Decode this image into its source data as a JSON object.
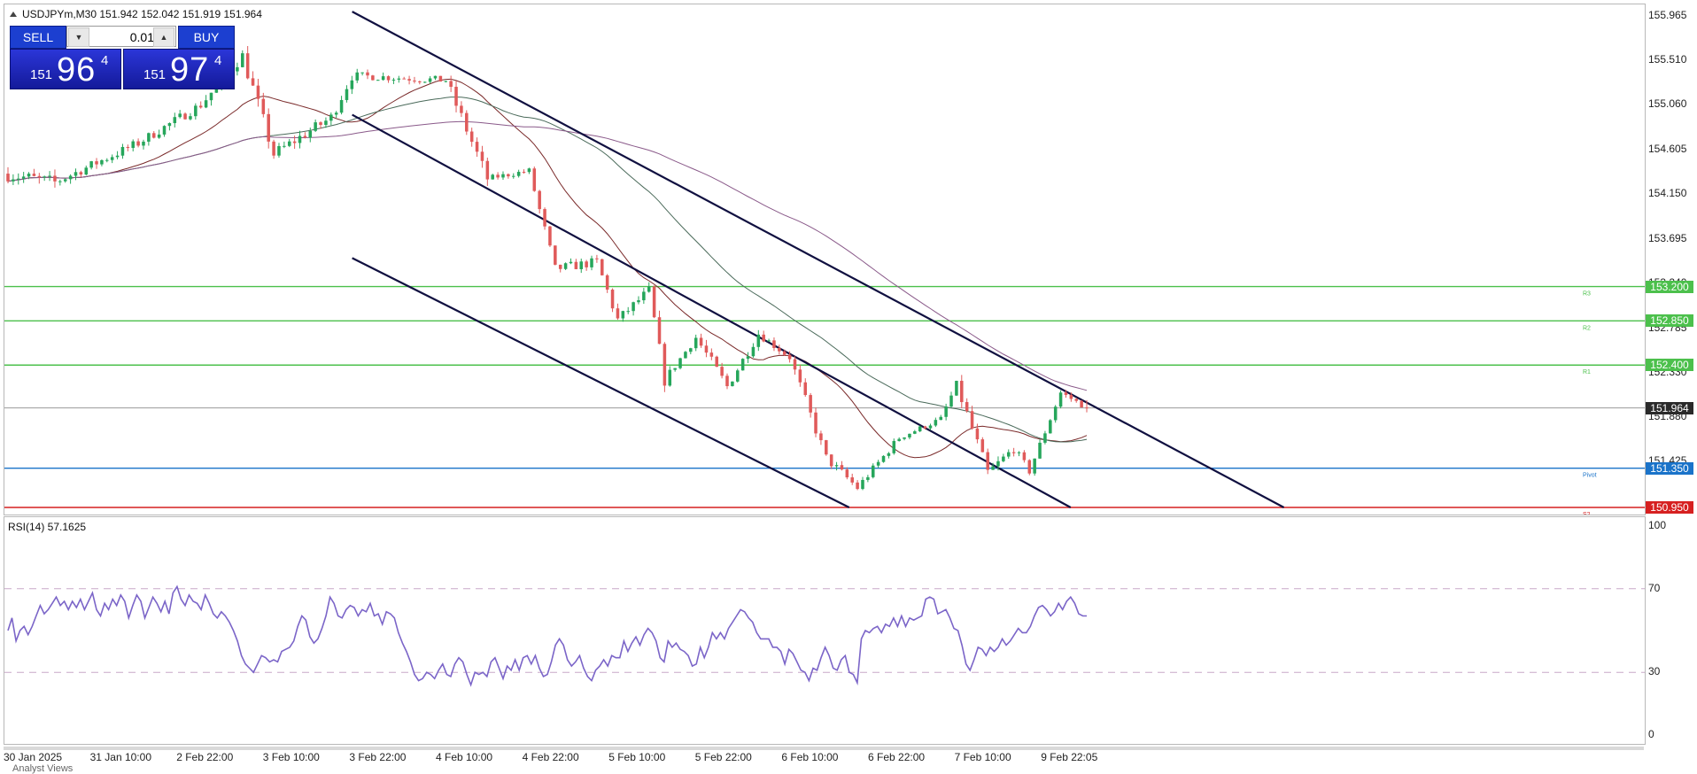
{
  "window": {
    "title": "USDJPYm,M30  151.942 152.042 151.919 151.964"
  },
  "trade_panel": {
    "sell_label": "SELL",
    "buy_label": "BUY",
    "lot_value": "0.01",
    "sell_price": {
      "prefix": "151",
      "big": "96",
      "sup": "4"
    },
    "buy_price": {
      "prefix": "151",
      "big": "97",
      "sup": "4"
    }
  },
  "icons": {
    "collapse": "triangle-up-icon",
    "decrease": "arrow-down-icon",
    "increase": "arrow-up-icon"
  },
  "colors": {
    "bull": "#26a65b",
    "bear": "#e05a5a",
    "channel": "#101040",
    "resistance": "#4cc04c",
    "pivot": "#1a73c9",
    "support": "#d62020",
    "rsi": "#7b65c8",
    "ma_fast": "#7a2a2a",
    "ma_mid": "#4a6a5a",
    "ma_slow": "#8a5a8a"
  },
  "price_axis": {
    "ticks": [
      "155.965",
      "155.510",
      "155.060",
      "154.605",
      "154.150",
      "153.695",
      "153.240",
      "152.785",
      "152.330",
      "151.880",
      "151.425"
    ]
  },
  "levels": [
    {
      "name": "R3",
      "value": 153.2,
      "label": "153.200",
      "color": "#4cc04c"
    },
    {
      "name": "R2",
      "value": 152.85,
      "label": "152.850",
      "color": "#4cc04c"
    },
    {
      "name": "R1",
      "value": 152.4,
      "label": "152.400",
      "color": "#4cc04c"
    },
    {
      "name": "Pivot",
      "value": 151.35,
      "label": "151.350",
      "color": "#1a73c9"
    },
    {
      "name": "S2",
      "value": 150.95,
      "label": "150.950",
      "color": "#d62020"
    }
  ],
  "current_price": {
    "value": 151.964,
    "label": "151.964"
  },
  "time_axis": {
    "labels": [
      "30 Jan 2025",
      "31 Jan 10:00",
      "2 Feb 22:00",
      "3 Feb 10:00",
      "3 Feb 22:00",
      "4 Feb 10:00",
      "4 Feb 22:00",
      "5 Feb 10:00",
      "5 Feb 22:00",
      "6 Feb 10:00",
      "6 Feb 22:00",
      "7 Feb 10:00",
      "9 Feb 22:05"
    ]
  },
  "rsi": {
    "title": "RSI(14) 57.1625",
    "ticks": [
      "100",
      "70",
      "30",
      "0"
    ]
  },
  "analyst_label": "Analyst Views",
  "chart_data": {
    "type": "candlestick",
    "symbol": "USDJPYm",
    "timeframe": "M30",
    "ohlc_header": {
      "open": 151.942,
      "high": 152.042,
      "low": 151.919,
      "close": 151.964
    },
    "ylim": [
      150.95,
      155.965
    ],
    "segments": [
      {
        "start": 154.35,
        "end": 154.26,
        "n": 10,
        "vol": 0.14
      },
      {
        "start": 154.26,
        "end": 154.66,
        "n": 16,
        "vol": 0.1
      },
      {
        "start": 154.66,
        "end": 155.05,
        "n": 12,
        "vol": 0.1
      },
      {
        "start": 155.05,
        "end": 155.55,
        "n": 8,
        "vol": 0.12
      },
      {
        "start": 155.55,
        "end": 154.55,
        "n": 6,
        "vol": 0.16
      },
      {
        "start": 154.55,
        "end": 154.92,
        "n": 11,
        "vol": 0.12
      },
      {
        "start": 154.92,
        "end": 155.35,
        "n": 4,
        "vol": 0.12
      },
      {
        "start": 155.35,
        "end": 155.3,
        "n": 18,
        "vol": 0.08
      },
      {
        "start": 155.3,
        "end": 154.3,
        "n": 8,
        "vol": 0.14
      },
      {
        "start": 154.3,
        "end": 154.38,
        "n": 8,
        "vol": 0.06
      },
      {
        "start": 154.38,
        "end": 153.38,
        "n": 5,
        "vol": 0.1
      },
      {
        "start": 153.38,
        "end": 153.45,
        "n": 8,
        "vol": 0.1
      },
      {
        "start": 153.45,
        "end": 152.86,
        "n": 4,
        "vol": 0.12
      },
      {
        "start": 152.86,
        "end": 153.16,
        "n": 6,
        "vol": 0.1
      },
      {
        "start": 153.16,
        "end": 152.25,
        "n": 3,
        "vol": 0.14
      },
      {
        "start": 152.25,
        "end": 152.68,
        "n": 6,
        "vol": 0.08
      },
      {
        "start": 152.68,
        "end": 152.18,
        "n": 6,
        "vol": 0.12
      },
      {
        "start": 152.18,
        "end": 152.72,
        "n": 6,
        "vol": 0.1
      },
      {
        "start": 152.72,
        "end": 152.48,
        "n": 6,
        "vol": 0.08
      },
      {
        "start": 152.48,
        "end": 151.45,
        "n": 7,
        "vol": 0.12
      },
      {
        "start": 151.45,
        "end": 151.15,
        "n": 6,
        "vol": 0.1
      },
      {
        "start": 151.15,
        "end": 151.66,
        "n": 8,
        "vol": 0.08
      },
      {
        "start": 151.66,
        "end": 151.85,
        "n": 8,
        "vol": 0.06
      },
      {
        "start": 151.85,
        "end": 152.2,
        "n": 3,
        "vol": 0.08
      },
      {
        "start": 152.2,
        "end": 151.3,
        "n": 6,
        "vol": 0.14
      },
      {
        "start": 151.3,
        "end": 151.55,
        "n": 5,
        "vol": 0.1
      },
      {
        "start": 151.55,
        "end": 151.32,
        "n": 3,
        "vol": 0.08
      },
      {
        "start": 151.32,
        "end": 152.12,
        "n": 6,
        "vol": 0.08
      },
      {
        "start": 152.12,
        "end": 151.964,
        "n": 5,
        "vol": 0.06
      }
    ],
    "channel_lines": [
      {
        "x1": 0.212,
        "y1": 156.0,
        "x2": 0.78,
        "y2": 150.95
      },
      {
        "x1": 0.212,
        "y1": 154.95,
        "x2": 0.65,
        "y2": 150.95
      },
      {
        "x1": 0.212,
        "y1": 153.49,
        "x2": 0.515,
        "y2": 150.95
      }
    ],
    "ma_series": [
      {
        "name": "MA fast",
        "color": "#7a2a2a",
        "period": 20
      },
      {
        "name": "MA mid",
        "color": "#4a6a5a",
        "period": 50
      },
      {
        "name": "MA slow",
        "color": "#8a5a8a",
        "period": 100
      }
    ],
    "rsi": {
      "period": 14,
      "last": 57.1625,
      "levels": [
        70,
        30
      ],
      "ylim": [
        0,
        100
      ],
      "values": [
        50,
        56,
        45,
        50,
        52,
        48,
        52,
        57,
        62,
        58,
        60,
        63,
        66,
        62,
        64,
        60,
        64,
        61,
        65,
        60,
        64,
        68,
        60,
        57,
        63,
        60,
        65,
        62,
        67,
        64,
        56,
        62,
        67,
        64,
        56,
        61,
        66,
        63,
        59,
        64,
        58,
        68,
        71,
        65,
        62,
        67,
        64,
        63,
        60,
        67,
        63,
        58,
        56,
        59,
        57,
        54,
        50,
        45,
        38,
        34,
        32,
        30,
        34,
        38,
        37,
        35,
        36,
        35,
        40,
        41,
        42,
        45,
        52,
        57,
        55,
        47,
        44,
        46,
        51,
        57,
        66,
        63,
        57,
        56,
        60,
        62,
        61,
        57,
        60,
        59,
        63,
        57,
        58,
        53,
        59,
        58,
        56,
        49,
        44,
        40,
        35,
        29,
        26,
        27,
        30,
        29,
        27,
        31,
        34,
        29,
        28,
        34,
        37,
        35,
        29,
        24,
        30,
        29,
        30,
        28,
        35,
        37,
        32,
        27,
        33,
        31,
        36,
        31,
        37,
        38,
        34,
        38,
        32,
        28,
        29,
        35,
        43,
        46,
        43,
        36,
        33,
        35,
        38,
        32,
        28,
        26,
        31,
        33,
        36,
        33,
        38,
        37,
        37,
        45,
        40,
        44,
        47,
        43,
        48,
        51,
        49,
        45,
        37,
        35,
        45,
        42,
        44,
        41,
        40,
        38,
        33,
        34,
        42,
        37,
        42,
        49,
        46,
        49,
        46,
        51,
        54,
        57,
        60,
        59,
        56,
        54,
        49,
        46,
        46,
        46,
        42,
        42,
        40,
        34,
        41,
        39,
        35,
        31,
        30,
        26,
        32,
        31,
        37,
        42,
        38,
        32,
        31,
        36,
        38,
        30,
        29,
        25,
        46,
        50,
        49,
        51,
        52,
        49,
        53,
        52,
        56,
        52,
        57,
        52,
        56,
        55,
        56,
        57,
        65,
        66,
        65,
        58,
        59,
        60,
        56,
        51,
        50,
        43,
        34,
        31,
        36,
        42,
        41,
        38,
        42,
        40,
        42,
        46,
        43,
        45,
        48,
        51,
        49,
        49,
        52,
        57,
        61,
        62,
        60,
        57,
        59,
        63,
        60,
        64,
        66,
        63,
        58,
        57,
        57
      ]
    }
  }
}
